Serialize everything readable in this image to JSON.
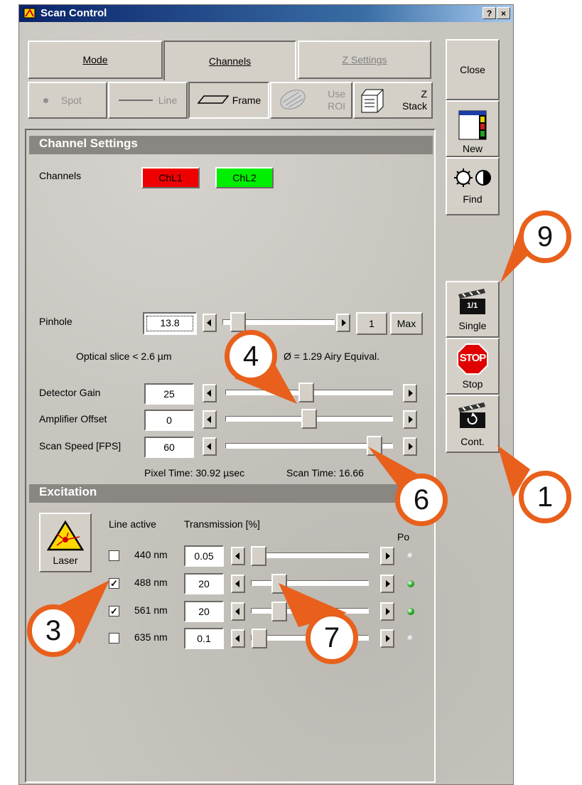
{
  "window": {
    "title": "Scan Control",
    "help_btn": "?",
    "close_btn": "×"
  },
  "tabs": [
    {
      "label": "Mode"
    },
    {
      "label": "Channels"
    },
    {
      "label": "Z Settings"
    }
  ],
  "scan_modes": {
    "spot": "Spot",
    "line": "Line",
    "frame": "Frame",
    "use_roi_1": "Use",
    "use_roi_2": "ROI",
    "zstack_1": "Z",
    "zstack_2": "Stack"
  },
  "side": {
    "close": "Close",
    "new": "New",
    "find": "Find",
    "single": "Single",
    "single_icon_text": "1/1",
    "stop": "Stop",
    "stop_icon_text": "STOP",
    "cont": "Cont."
  },
  "channel_settings": {
    "header": "Channel Settings",
    "channels_label": "Channels",
    "ch1": "ChL1",
    "ch2": "ChL2",
    "ch1_color": "#ee0000",
    "ch2_color": "#00ee00"
  },
  "pinhole": {
    "label": "Pinhole",
    "value": "13.8",
    "step": "1",
    "max": "Max",
    "optical_slice": "Optical slice < 2.6 µm",
    "airy": "Ø = 1.29 Airy Equival.",
    "slider_fraction": 0.08
  },
  "detector_gain": {
    "label": "Detector Gain",
    "value": "25",
    "slider_fraction": 0.48
  },
  "amplifier_offset": {
    "label": "Amplifier Offset",
    "value": "0",
    "slider_fraction": 0.5
  },
  "scan_speed": {
    "label": "Scan Speed [FPS]",
    "value": "60",
    "slider_fraction": 0.93
  },
  "timing": {
    "pixel_time": "Pixel Time: 30.92 µsec",
    "scan_time": "Scan Time: 16.66"
  },
  "excitation": {
    "header": "Excitation",
    "laser": "Laser",
    "line_active": "Line active",
    "transmission": "Transmission [%]",
    "power_col": "Po",
    "lines": [
      {
        "nm": "440 nm",
        "checked": false,
        "value": "0.05",
        "led": "#b8b8b8",
        "slider_fraction": 0.0
      },
      {
        "nm": "488 nm",
        "checked": true,
        "value": "20",
        "led": "#19a019",
        "slider_fraction": 0.2
      },
      {
        "nm": "561 nm",
        "checked": true,
        "value": "20",
        "led": "#19a019",
        "slider_fraction": 0.2
      },
      {
        "nm": "635 nm",
        "checked": false,
        "value": "0.1",
        "led": "#b8b8b8",
        "slider_fraction": 0.01
      }
    ]
  },
  "callouts": {
    "c1": "1",
    "c3": "3",
    "c4": "4",
    "c6": "6",
    "c7": "7",
    "c9": "9"
  },
  "colors": {
    "accent": "#e8601b"
  }
}
